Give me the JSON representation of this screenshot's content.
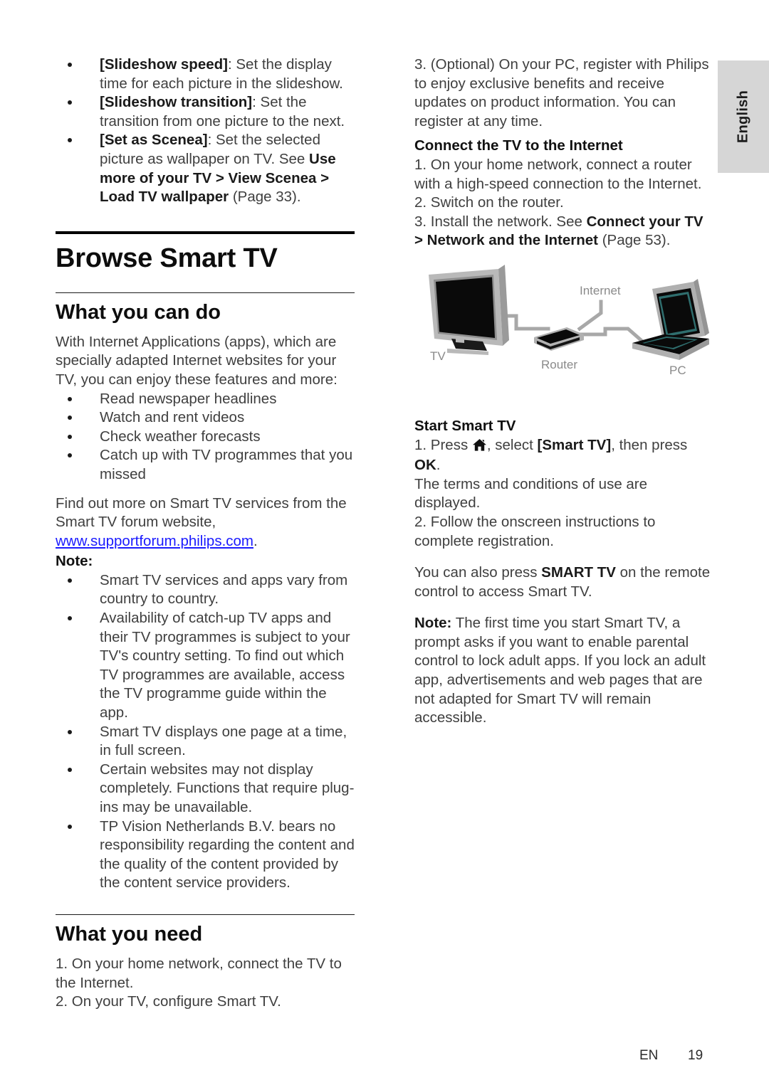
{
  "sidetab": {
    "language": "English"
  },
  "colors": {
    "link": "#1a1aff",
    "tab_bg": "#d6d6d6",
    "text": "#3f3f3f",
    "heading": "#0d0d0d"
  },
  "left_column": {
    "continued_bullets": [
      {
        "bold": "[Slideshow speed]",
        "rest": ": Set the display time for each picture in the slideshow."
      },
      {
        "bold": "[Slideshow transition]",
        "rest": ": Set the transition from one picture to the next."
      },
      {
        "bold": "[Set as Scenea]",
        "rest": ": Set the selected picture as wallpaper on TV. See ",
        "bold2": "Use more of your TV > View Scenea > Load TV wallpaper",
        "rest2": " (Page 33)."
      }
    ],
    "chapter_title": "Browse Smart TV",
    "section_what_you_can_do": {
      "title": "What you can do",
      "intro": "With Internet Applications (apps), which are specially adapted Internet websites for your TV, you can enjoy these features and more:",
      "features": [
        "Read newspaper headlines",
        "Watch and rent videos",
        "Check weather forecasts",
        "Catch up with TV programmes that you missed"
      ],
      "find_out_more_prefix": "Find out more on Smart TV services from the Smart TV forum website, ",
      "find_out_more_link": "www.supportforum.philips.com",
      "find_out_more_suffix": ".",
      "note_label": "Note:",
      "notes": [
        "Smart TV services and apps vary from country to country.",
        "Availability of catch-up TV apps and their TV programmes is subject to your TV's country setting. To find out which TV programmes are available, access the TV programme guide within the app.",
        "Smart TV displays one page at a time, in full screen.",
        "Certain websites may not display completely. Functions that require plug-ins may be unavailable.",
        "TP Vision Netherlands B.V. bears no responsibility regarding the content and the quality of the content provided by the content service providers."
      ]
    },
    "section_what_you_need": {
      "title": "What you need",
      "steps": [
        "1. On your home network, connect the TV to the Internet.",
        "2. On your TV, configure Smart TV."
      ]
    }
  },
  "right_column": {
    "step_3_optional": "3. (Optional) On your PC, register with Philips to enjoy exclusive benefits and receive updates on product information. You can register at any time.",
    "connect_heading": "Connect the TV to the Internet",
    "connect_step_1": "1. On your home network, connect a router with a high-speed connection to the Internet.",
    "connect_step_2": "2. Switch on the router.",
    "connect_step_3_prefix": "3. Install the network. See ",
    "connect_step_3_bold": "Connect your TV > Network and the Internet",
    "connect_step_3_suffix": " (Page 53).",
    "diagram": {
      "label_tv": "TV",
      "label_router": "Router",
      "label_internet": "Internet",
      "label_pc": "PC"
    },
    "start_heading": "Start Smart TV",
    "start_step_1_prefix": "1. Press ",
    "start_step_1_icon": "home-icon",
    "start_step_1_mid": ", select ",
    "start_step_1_bold": "[Smart TV]",
    "start_step_1_mid2": ", then press ",
    "start_step_1_bold2": "OK",
    "start_step_1_suffix": ".",
    "terms_text": "The terms and conditions of use are displayed.",
    "start_step_2": "2. Follow the onscreen instructions to complete registration.",
    "remote_prefix": "You can also press ",
    "remote_bold": "SMART TV",
    "remote_suffix": " on the remote control to access Smart TV.",
    "note_label": "Note:",
    "note_text": " The first time you start Smart TV, a prompt asks if you want to enable parental control to lock adult apps. If you lock an adult app, advertisements and web pages that are not adapted for Smart TV will remain accessible."
  },
  "footer": {
    "language_code": "EN",
    "page_number": "19"
  }
}
